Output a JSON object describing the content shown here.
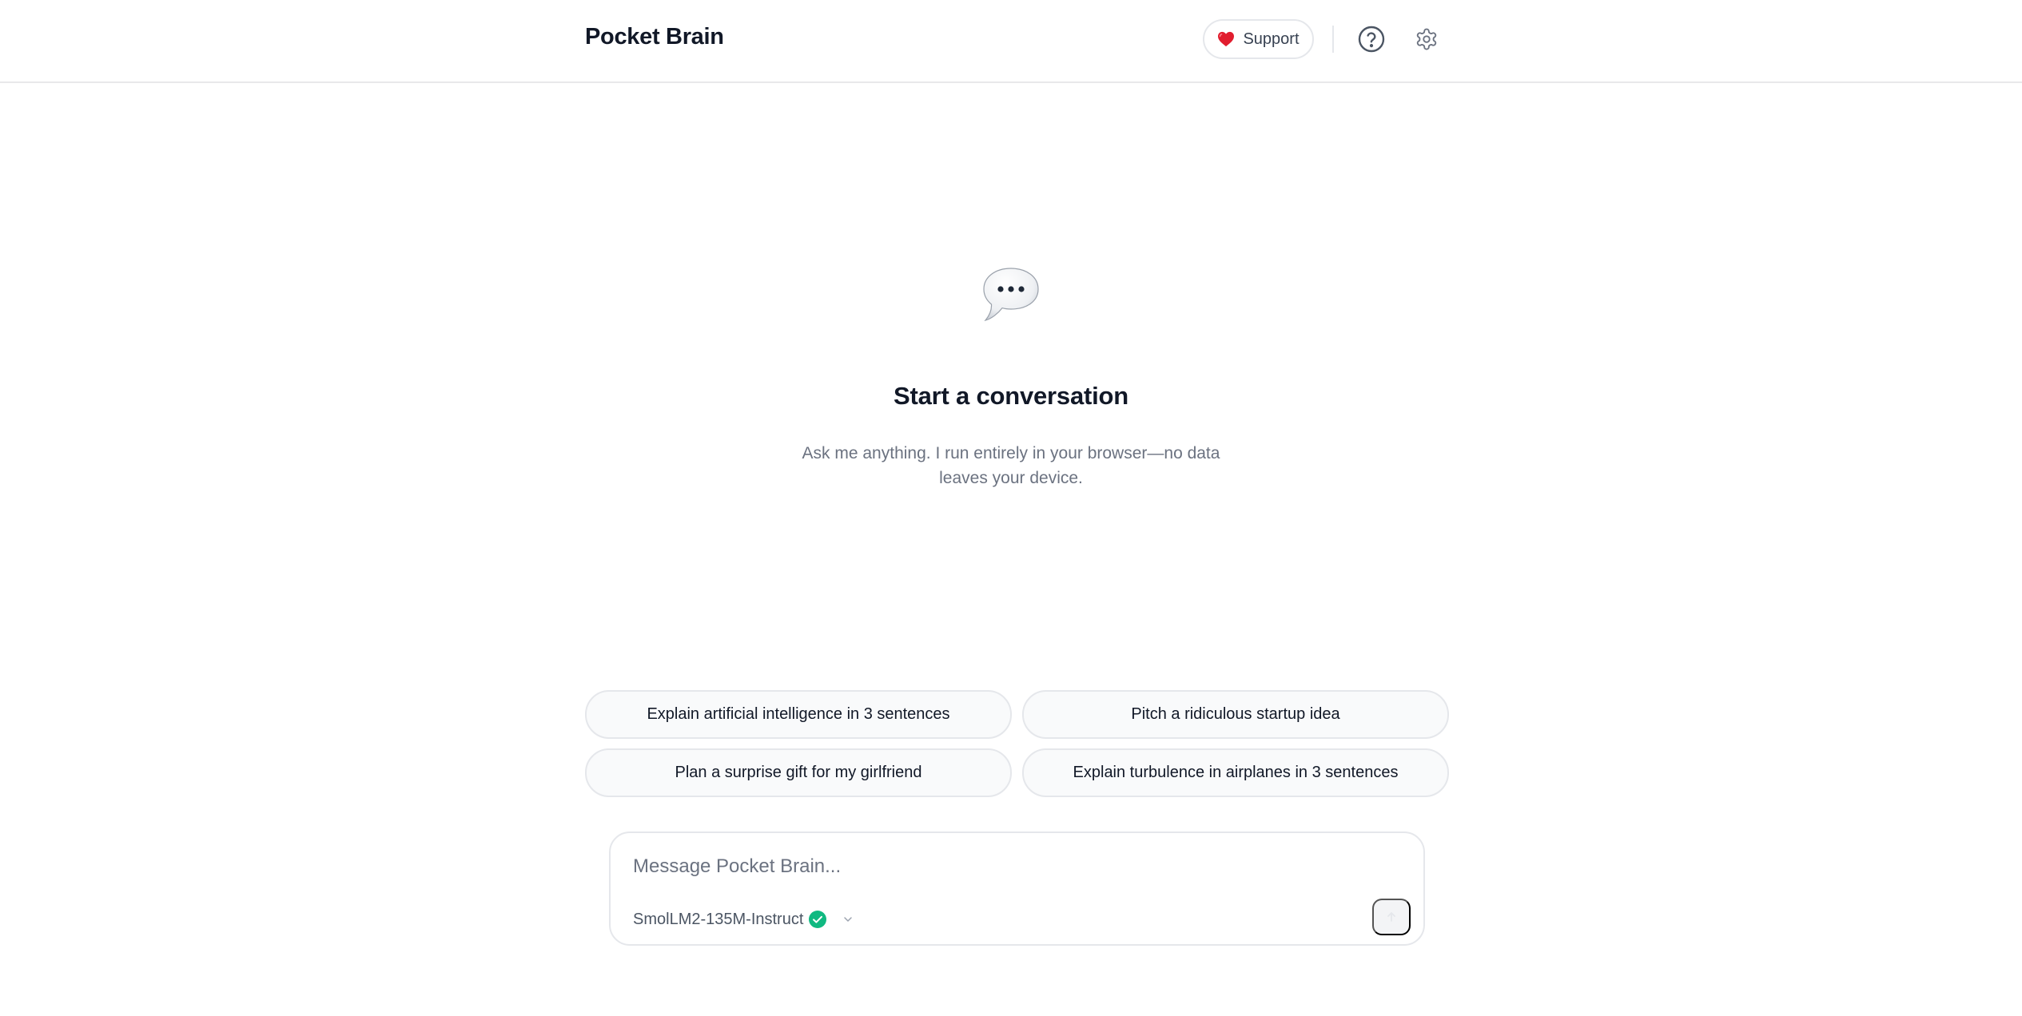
{
  "app": {
    "title": "Pocket Brain"
  },
  "header": {
    "support_label": "Support",
    "icons": {
      "support": "heart-icon",
      "help": "help-circle-icon",
      "settings": "gear-icon"
    }
  },
  "empty_state": {
    "icon": "speech-bubble-icon",
    "title": "Start a conversation",
    "subtitle": "Ask me anything. I run entirely in your browser—no data leaves your device."
  },
  "suggestions": [
    "Explain artificial intelligence in 3 sentences",
    "Pitch a ridiculous startup idea",
    "Plan a surprise gift for my girlfriend",
    "Explain turbulence in airplanes in 3 sentences"
  ],
  "composer": {
    "placeholder": "Message Pocket Brain...",
    "value": "",
    "model": "SmolLM2-135M-Instruct",
    "model_status": "ready",
    "send_icon": "arrow-up-icon"
  },
  "colors": {
    "accent_green": "#10b981",
    "heart_red": "#e11d2e",
    "muted_text": "#6b7280",
    "border": "#e5e7eb"
  }
}
